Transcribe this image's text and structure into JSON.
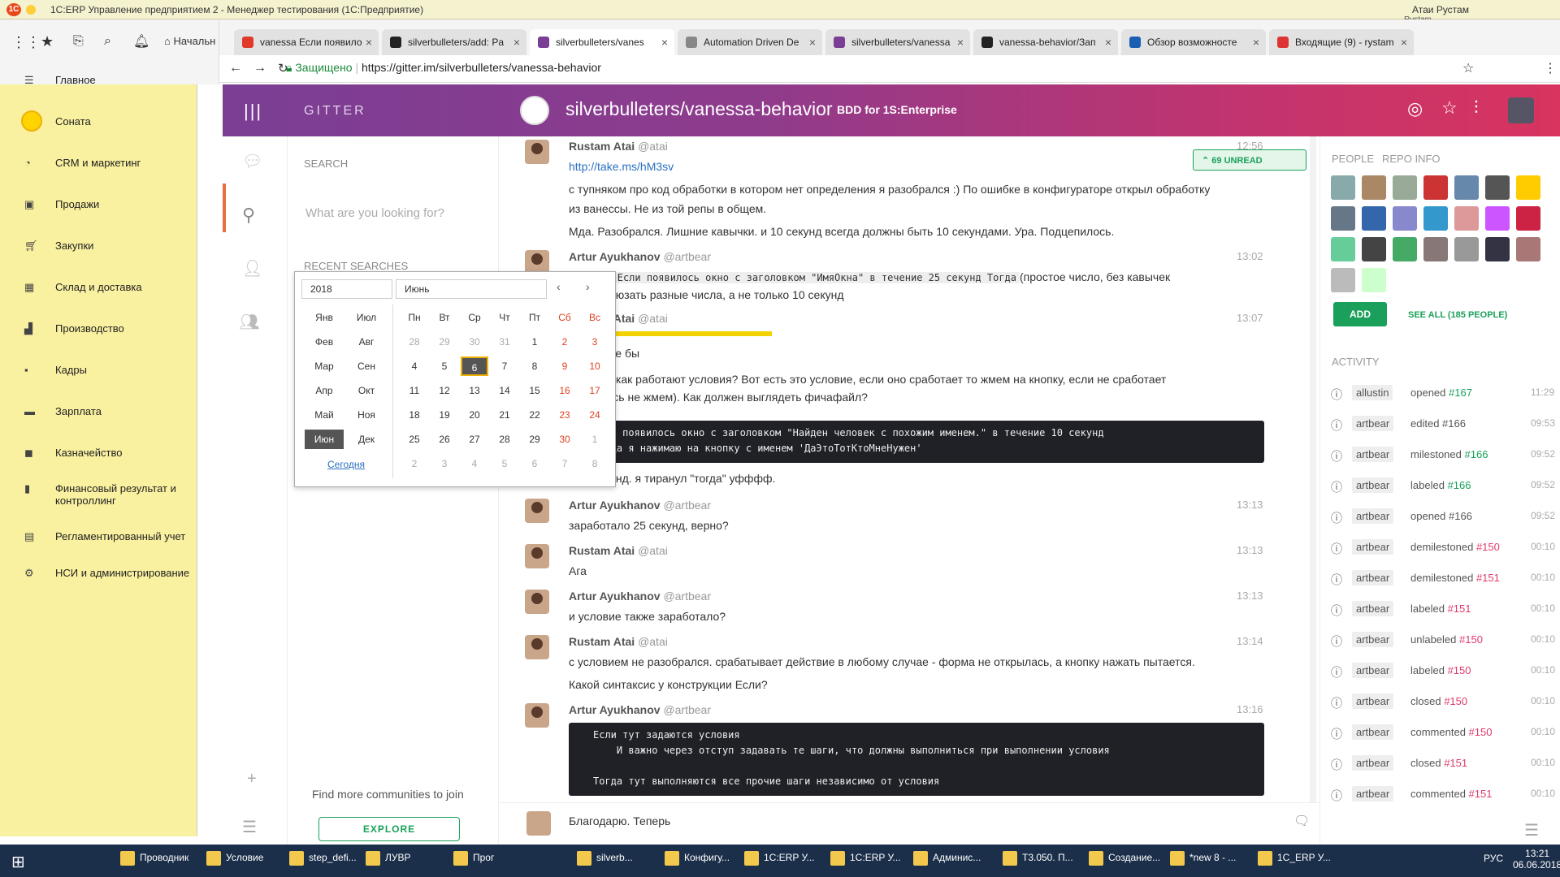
{
  "window": {
    "title": "1С:ERP Управление предприятием 2 - Менеджер тестирования (1С:Предприятие)",
    "user": "Атаи Рустам",
    "user2": "Rystam"
  },
  "tabs": [
    {
      "label": "vanessa Если появило",
      "color": "#e03a2a"
    },
    {
      "label": "silverbulleters/add: Pa",
      "color": "#222"
    },
    {
      "label": "silverbulleters/vanes",
      "color": "#7a3e94"
    },
    {
      "label": "Automation Driven De",
      "color": "#888"
    },
    {
      "label": "silverbulleters/vanessa",
      "color": "#7a3e94"
    },
    {
      "label": "vanessa-behavior/Зап",
      "color": "#222"
    },
    {
      "label": "Обзор возможносте",
      "color": "#1b5fb5"
    },
    {
      "label": "Входящие (9) - rystam",
      "color": "#d33"
    }
  ],
  "toolbar": {
    "home_label": "Начальн"
  },
  "address": {
    "secure": "Защищено",
    "url": "https://gitter.im/silverbulleters/vanessa-behavior"
  },
  "sidebar": {
    "items": [
      {
        "label": "Главное",
        "icon": "menu-icon"
      },
      {
        "label": "Соната",
        "icon": "sun-icon"
      },
      {
        "label": "CRM и маркетинг",
        "icon": "pie-icon"
      },
      {
        "label": "Продажи",
        "icon": "bag-icon"
      },
      {
        "label": "Закупки",
        "icon": "cart-icon"
      },
      {
        "label": "Склад и доставка",
        "icon": "warehouse-icon"
      },
      {
        "label": "Производство",
        "icon": "factory-icon"
      },
      {
        "label": "Кадры",
        "icon": "people-icon"
      },
      {
        "label": "Зарплата",
        "icon": "money-icon"
      },
      {
        "label": "Казначейство",
        "icon": "treasury-icon"
      },
      {
        "label": "Финансовый результат и контроллинг",
        "icon": "chart-icon"
      },
      {
        "label": "Регламентированный учет",
        "icon": "doc-icon"
      },
      {
        "label": "НСИ и администрирование",
        "icon": "gear-icon"
      }
    ]
  },
  "gitter": {
    "brand": "GITTER",
    "room": "silverbulleters/vanessa-behavior",
    "topic": "BDD for 1S:Enterprise",
    "search_heading": "SEARCH",
    "search_placeholder": "What are you looking for?",
    "recent": "RECENT SEARCHES",
    "find_more": "Find more communities to join",
    "explore": "EXPLORE",
    "unread": "69 UNREAD"
  },
  "calendar": {
    "year": "2018",
    "month": "Июнь",
    "today": "Сегодня",
    "months_left": [
      "Янв",
      "Фев",
      "Мар",
      "Апр",
      "Май",
      "Июн"
    ],
    "months_right": [
      "Июл",
      "Авг",
      "Сен",
      "Окт",
      "Ноя",
      "Дек"
    ],
    "weekdays": [
      "Пн",
      "Вт",
      "Ср",
      "Чт",
      "Пт",
      "Сб",
      "Вс"
    ],
    "weeks": [
      [
        "28",
        "29",
        "30",
        "31",
        "1",
        "2",
        "3"
      ],
      [
        "4",
        "5",
        "6",
        "7",
        "8",
        "9",
        "10"
      ],
      [
        "11",
        "12",
        "13",
        "14",
        "15",
        "16",
        "17"
      ],
      [
        "18",
        "19",
        "20",
        "21",
        "22",
        "23",
        "24"
      ],
      [
        "25",
        "26",
        "27",
        "28",
        "29",
        "30",
        "1"
      ],
      [
        "2",
        "3",
        "4",
        "5",
        "6",
        "7",
        "8"
      ]
    ],
    "selected": "6"
  },
  "messages": [
    {
      "name": "Rustam Atai",
      "nick": "@atai",
      "time": "12:56",
      "link": "http://take.ms/hM3sv",
      "lines": [
        "с тупняком про код обработки в котором нет определения я разобрался :) По ошибке в конфигураторе открыл обработку",
        "из ванессы. Не из той репы в общем.",
        "Мда. Разобрался. Лишние кавычки. и 10 секунд всегда должны быть 10 секундами. Ура. Подцепилось."
      ]
    },
    {
      "name": "Artur Ayukhanov",
      "nick": "@artbear",
      "time": "13:02",
      "lines": [
        "зать как ",
        "(простое число, без кавычек",
        "о можно юзать разные числа, а не только 10 секунд"
      ],
      "inline_code": "Если появилось окно с заголовком \"ИмяОкна\" в течение 25 секунд Тогда"
    },
    {
      "name": "Rustam Atai",
      "nick": "@atai",
      "time": "13:07",
      "lines": [
        "сен вроде бы",
        "одскажи как работают условия? Вот есть это условие, если оно сработает то жмем на кнопку, если не сработает",
        "оқтрылось не жмем). Как должен выглядеть фичафайл?",
        "т 25 секунд. я тиранул \"тогда\" уфффф."
      ],
      "code": [
        "Если появилось окно с заголовком \"Найден человек с похожим именем.\" в течение 10 секунд",
        "Тогда я нажимаю на кнопку с именем 'ДаЭтоТотКтоМнеНужен'"
      ]
    },
    {
      "name": "Artur Ayukhanov",
      "nick": "@artbear",
      "time": "13:13",
      "lines": [
        "заработало 25 секунд, верно?"
      ]
    },
    {
      "name": "Rustam Atai",
      "nick": "@atai",
      "time": "13:13",
      "lines": [
        "Ага"
      ]
    },
    {
      "name": "Artur Ayukhanov",
      "nick": "@artbear",
      "time": "13:13",
      "lines": [
        "и условие также заработало?"
      ]
    },
    {
      "name": "Rustam Atai",
      "nick": "@atai",
      "time": "13:14",
      "lines": [
        "с условием не разобрался. срабатывает действие в любому случае - форма не открылась, а кнопку нажать пытается.",
        "Какой синтаксис у конструкции Если?"
      ]
    },
    {
      "name": "Artur Ayukhanov",
      "nick": "@artbear",
      "time": "13:16",
      "code": [
        "Если тут задаются условия",
        "    И важно через отступ задавать те шаги, что должны выполниться при выполнении условия",
        "",
        "Тогда тут выполняются все прочие шаги независимо от условия"
      ]
    }
  ],
  "composer": {
    "text": "Благодарю. Теперь"
  },
  "right": {
    "people": "PEOPLE",
    "repo": "REPO INFO",
    "add": "ADD",
    "see_all": "SEE ALL (185 PEOPLE)",
    "activity": "ACTIVITY",
    "items": [
      {
        "user": "allustin",
        "action": "opened",
        "ref": "#167",
        "time": "11:29",
        "kind": "green"
      },
      {
        "user": "artbear",
        "action": "edited #166",
        "ref": "",
        "time": "09:53",
        "kind": ""
      },
      {
        "user": "artbear",
        "action": "milestoned",
        "ref": "#166",
        "time": "09:52",
        "kind": "green"
      },
      {
        "user": "artbear",
        "action": "labeled",
        "ref": "#166",
        "time": "09:52",
        "kind": "green"
      },
      {
        "user": "artbear",
        "action": "opened #166",
        "ref": "",
        "time": "09:52",
        "kind": ""
      },
      {
        "user": "artbear",
        "action": "demilestoned",
        "ref": "#150",
        "time": "00:10",
        "kind": "pink"
      },
      {
        "user": "artbear",
        "action": "demilestoned",
        "ref": "#151",
        "time": "00:10",
        "kind": "pink"
      },
      {
        "user": "artbear",
        "action": "labeled",
        "ref": "#151",
        "time": "00:10",
        "kind": "pink"
      },
      {
        "user": "artbear",
        "action": "unlabeled",
        "ref": "#150",
        "time": "00:10",
        "kind": "pink"
      },
      {
        "user": "artbear",
        "action": "labeled",
        "ref": "#150",
        "time": "00:10",
        "kind": "pink"
      },
      {
        "user": "artbear",
        "action": "closed",
        "ref": "#150",
        "time": "00:10",
        "kind": "pink"
      },
      {
        "user": "artbear",
        "action": "commented",
        "ref": "#150",
        "time": "00:10",
        "kind": "pink"
      },
      {
        "user": "artbear",
        "action": "closed",
        "ref": "#151",
        "time": "00:10",
        "kind": "pink"
      },
      {
        "user": "artbear",
        "action": "commented",
        "ref": "#151",
        "time": "00:10",
        "kind": "pink"
      }
    ]
  },
  "taskbar": {
    "items": [
      "Проводник",
      "Условие",
      "step_defi...",
      "ЛУВР",
      "Прог",
      "silverb...",
      "Конфигу...",
      "1С:ERP У...",
      "1С:ERP У...",
      "Админис...",
      "T3.050. П...",
      "Создание...",
      "*new 8 - ...",
      "1С_ERP У..."
    ],
    "lang": "РУС",
    "time": "13:21",
    "date": "06.06.2018"
  },
  "colors": {
    "gitter_grad_start": "#7a3e94",
    "gitter_grad_end": "#d8345f",
    "sidebar": "#f9f0a0",
    "accent_green": "#1aa05a",
    "accent_pink": "#e03a6a"
  }
}
